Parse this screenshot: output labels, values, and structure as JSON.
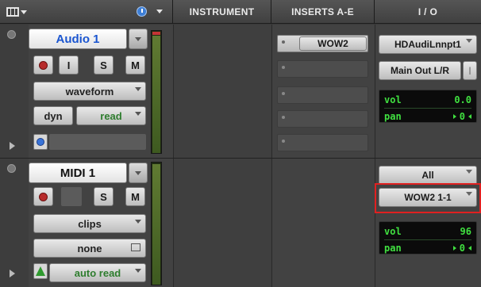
{
  "header": {
    "columns": [
      "INSTRUMENT",
      "INSERTS A-E",
      "I / O"
    ]
  },
  "tracks": [
    {
      "name": "Audio 1",
      "buttons": {
        "input": "I",
        "solo": "S",
        "mute": "M"
      },
      "view": "waveform",
      "automation_mode": "read",
      "dyn": "dyn",
      "inserts": [
        "WOW2",
        "",
        "",
        "",
        ""
      ],
      "io": {
        "input": "HDAudiLnnpt1",
        "output": "Main Out L/R"
      },
      "vol": "0.0",
      "pan": "0"
    },
    {
      "name": "MIDI 1",
      "buttons": {
        "solo": "S",
        "mute": "M"
      },
      "view": "clips",
      "playlist": "none",
      "automation_mode": "auto read",
      "io": {
        "input": "All",
        "output": "WOW2 1-1"
      },
      "vol": "96",
      "pan": "0"
    }
  ],
  "colors": {
    "track_name_audio": "#1a55d0",
    "highlight": "#e02020",
    "readout": "#40e040"
  },
  "icons": [
    "view-menu-icon",
    "clock-icon",
    "record-icon",
    "automation-icon",
    "midi-tri-icon",
    "window-icon"
  ]
}
